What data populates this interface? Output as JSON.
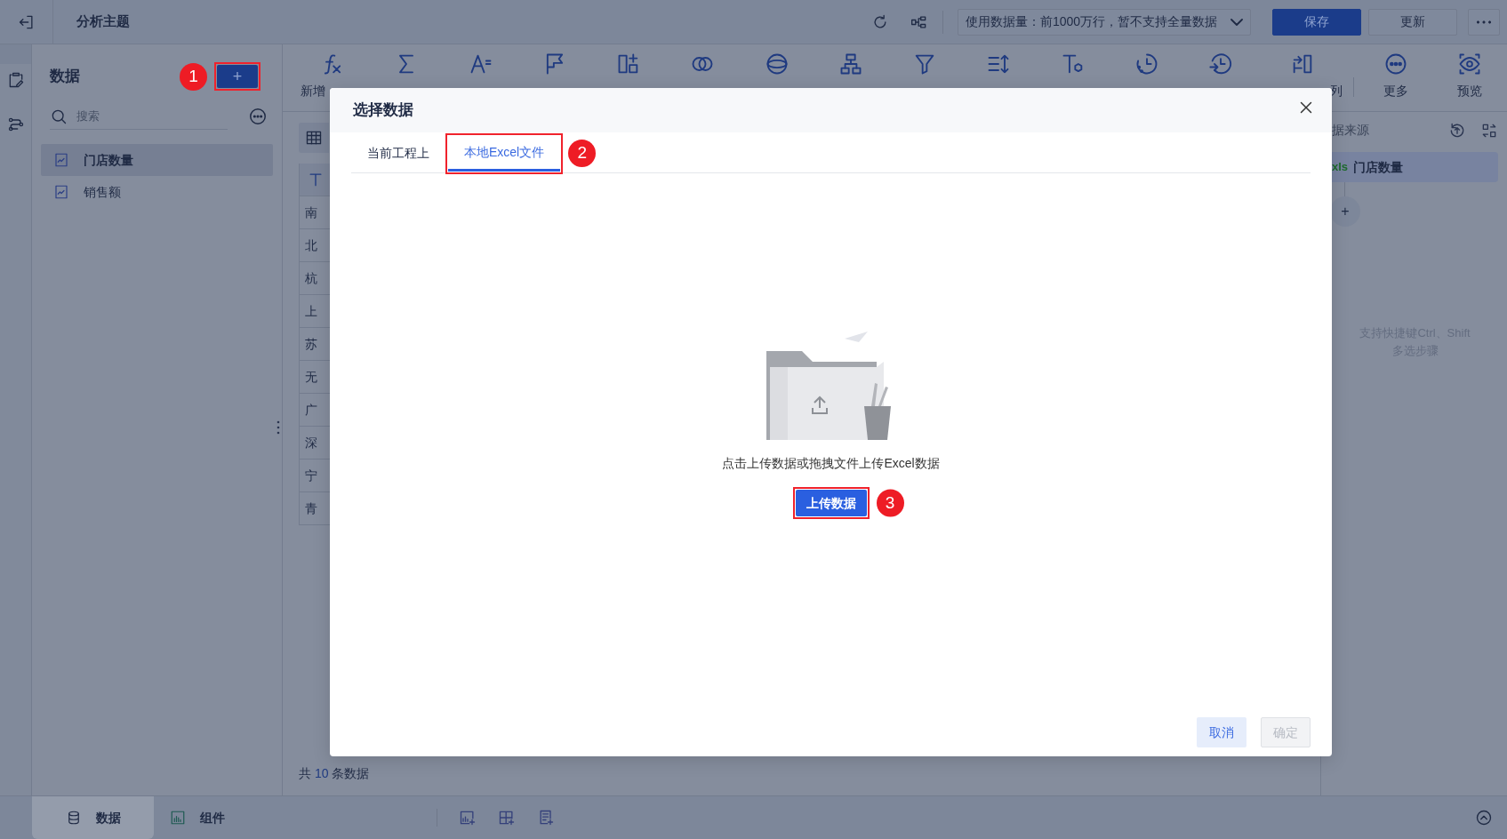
{
  "topbar": {
    "title": "分析主题",
    "data_scope": "使用数据量：前1000万行，暂不支持全量数据",
    "buttons": [
      {
        "label": "保存",
        "kind": "primary"
      },
      {
        "label": "更新",
        "kind": "default"
      }
    ]
  },
  "left_panel": {
    "title": "数据",
    "add_button": {
      "label": "+",
      "highlighted": true,
      "callout": "1"
    },
    "search": {
      "placeholder": "搜索"
    },
    "items": [
      {
        "label": "门店数量",
        "selected": true
      },
      {
        "label": "销售额",
        "selected": false
      }
    ]
  },
  "toolbar": {
    "left_label": "新增",
    "right_labels": [
      "列",
      "更多",
      "预览"
    ]
  },
  "table": {
    "rows": [
      "南",
      "北",
      "杭",
      "上",
      "苏",
      "无",
      "广",
      "深",
      "宁",
      "青"
    ],
    "footer": {
      "prefix": "共",
      "count": "10",
      "suffix": "条数据"
    }
  },
  "right_panel": {
    "title": "据来源",
    "steps": [
      {
        "badge": "xls",
        "label": "门店数量",
        "selected": true
      }
    ],
    "add_label": "+",
    "hint_lines": [
      "支持快捷键Ctrl、Shift",
      "多选步骤"
    ]
  },
  "bottom_tabs": [
    {
      "label": "数据",
      "selected": true
    },
    {
      "label": "组件",
      "selected": false
    }
  ],
  "dialog": {
    "title": "选择数据",
    "tabs": [
      {
        "label": "当前工程上",
        "selected": false,
        "highlighted": false
      },
      {
        "label": "本地Excel文件",
        "selected": true,
        "highlighted": true,
        "callout": "2"
      }
    ],
    "hint": "点击上传数据或拖拽文件上传Excel数据",
    "upload_button": {
      "label": "上传数据",
      "highlighted": true,
      "callout": "3"
    },
    "buttons": [
      {
        "label": "取消",
        "disabled": false
      },
      {
        "label": "确定",
        "disabled": true
      }
    ]
  }
}
